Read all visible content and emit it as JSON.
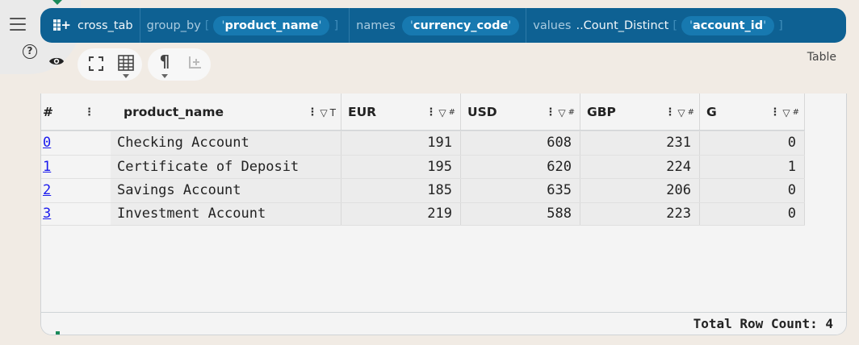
{
  "command": {
    "op": "cross_tab",
    "group_by_kw": "group_by",
    "group_by_value": "product_name",
    "names_kw": "names",
    "names_value": "currency_code",
    "values_kw": "values",
    "values_fn": "..Count_Distinct",
    "values_value": "account_id"
  },
  "view": {
    "label": "Table"
  },
  "table": {
    "columns": [
      "#",
      "product_name",
      "EUR",
      "USD",
      "GBP",
      "G"
    ],
    "rows": [
      {
        "idx": "0",
        "product_name": "Checking Account",
        "EUR": "191",
        "USD": "608",
        "GBP": "231",
        "G": "0"
      },
      {
        "idx": "1",
        "product_name": "Certificate of Deposit",
        "EUR": "195",
        "USD": "620",
        "GBP": "224",
        "G": "1"
      },
      {
        "idx": "2",
        "product_name": "Savings Account",
        "EUR": "185",
        "USD": "635",
        "GBP": "206",
        "G": "0"
      },
      {
        "idx": "3",
        "product_name": "Investment Account",
        "EUR": "219",
        "USD": "588",
        "GBP": "223",
        "G": "0"
      }
    ]
  },
  "footer": {
    "total_label": "Total Row Count: 4"
  },
  "icons": {
    "menu": "hamburger-icon",
    "help": "question-circle-icon",
    "eye": "eye-icon",
    "expand": "expand-icon",
    "grid": "table-grid-icon",
    "pilcrow": "pilcrow-icon",
    "insert_row": "insert-row-icon",
    "filter": "filter-icon",
    "kebab": "kebab-icon",
    "crosstab": "crosstab-add-icon"
  },
  "colors": {
    "command_bar": "#0e6193",
    "pill": "#1779b0",
    "link": "#1a1aee",
    "background": "#f1ebe4"
  }
}
